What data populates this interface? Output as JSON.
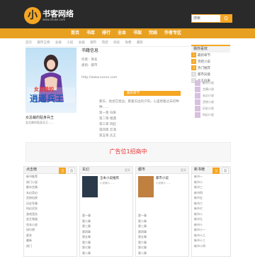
{
  "header": {
    "logo_mark": "小",
    "logo_text": "书客网络",
    "logo_sub": "www.shuke.com",
    "search_placeholder": "搜索",
    "search_button": "Q"
  },
  "nav": {
    "items": [
      "首页",
      "书库",
      "排行",
      "全本",
      "书架",
      "完结",
      "作者专区"
    ]
  },
  "breadcrumb": [
    "首页",
    "都市言情",
    "总裁",
    "小说",
    "总裁",
    "都市",
    "完结",
    "阅读",
    "免费",
    "最新"
  ],
  "book": {
    "title": "女总裁的贴身兵王",
    "cover_title": "逍遥兵王",
    "cover_sub": "女总裁的",
    "excerpt_short": "女总裁的贴身兵王……",
    "info_title": "书籍信息",
    "info_lines": [
      "作者：佚名",
      "类别：都市",
      "状态：连载",
      "字数：…"
    ],
    "url": "http://www.xxxxx.com",
    "section_head": "最新章节",
    "excerpt": [
      "那天，他坐在窗边，看着天边的夕阳，心里想着过去的种种……",
      "第一章 归来",
      "第二章 相遇",
      "第三章 风起",
      "第四章 云涌",
      "第五章 兵王"
    ]
  },
  "side_rank": {
    "title": "猜你喜欢",
    "items": [
      {
        "num": "1",
        "label": "最新章节"
      },
      {
        "num": "2",
        "label": "完结小说"
      },
      {
        "num": "3",
        "label": "热门推荐"
      },
      {
        "num": "4",
        "label": "都市异能"
      },
      {
        "num": "5",
        "label": "兵王归来"
      }
    ],
    "mini": [
      "都市小说",
      "言情小说",
      "玄幻小说",
      "武侠小说",
      "历史小说",
      "科幻小说"
    ]
  },
  "ad": {
    "text": "广告位1招商中"
  },
  "panels": [
    {
      "title": "点击榜",
      "tabs": [
        "日",
        "月"
      ],
      "rows": [
        "新书推荐",
        "热门小说",
        "都市言情",
        "玄幻奇幻",
        "武侠仙侠",
        "历史军事",
        "科幻灵异",
        "游戏竞技",
        "女生频道",
        "完本小说",
        "排行榜",
        "更多",
        "最新",
        "热门"
      ]
    },
    {
      "title": "玄幻",
      "more": "更多",
      "feat_title": "全本小说推荐",
      "feat_desc": "小说简介……",
      "rows": [
        "第一章",
        "第二章",
        "第三章",
        "第四章",
        "第五章",
        "第六章",
        "第七章",
        "第八章"
      ]
    },
    {
      "title": "都市",
      "more": "更多",
      "feat_title": "都市小说",
      "feat_desc": "小说简介……",
      "rows": [
        "第一章",
        "第二章",
        "第三章",
        "第四章",
        "第五章",
        "第六章",
        "第七章",
        "第八章"
      ]
    },
    {
      "title": "新书榜",
      "tabs": [
        "日",
        "月"
      ],
      "rows": [
        "新书一",
        "新书二",
        "新书三",
        "新书四",
        "新书五",
        "新书六",
        "新书七",
        "新书八",
        "新书九",
        "新书十",
        "新书十一",
        "新书十二",
        "新书十三",
        "新书十四"
      ]
    }
  ]
}
